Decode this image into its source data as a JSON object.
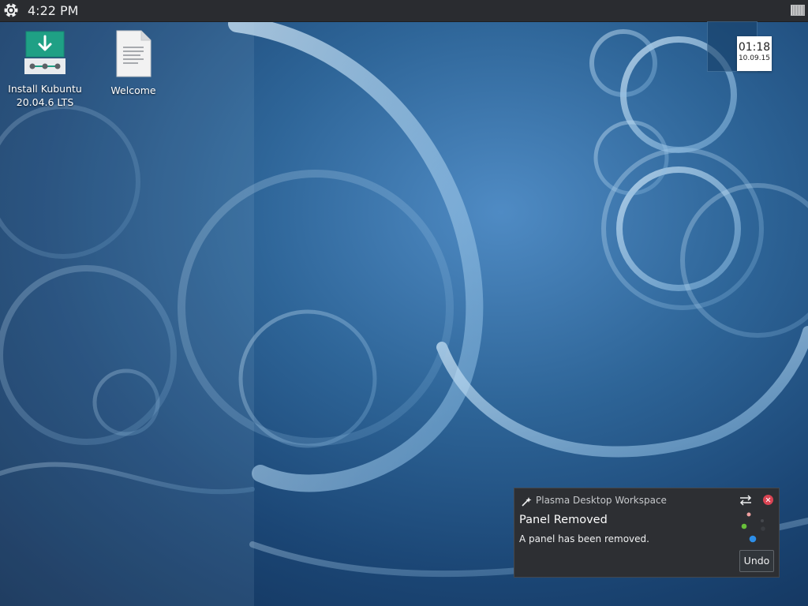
{
  "panel": {
    "clock": "4:22 PM",
    "launcher_icon": "kde-launcher-icon",
    "pager_icon": "virtual-desktop-pager-icon"
  },
  "desktop_icons": [
    {
      "label": "Install Kubuntu 20.04.6 LTS",
      "icon": "installer-download-icon"
    },
    {
      "label": "Welcome",
      "icon": "text-document-icon"
    }
  ],
  "clock_widget": {
    "time": "01:18",
    "date": "10.09.15"
  },
  "notification": {
    "app_name": "Plasma Desktop Workspace",
    "title": "Panel Removed",
    "body": "A panel has been removed.",
    "undo_label": "Undo",
    "accent_close": "#da4453"
  },
  "colors": {
    "panel_bg": "#2a2c30",
    "notification_bg": "#2d2f33",
    "wallpaper_base": "#1b4675"
  }
}
